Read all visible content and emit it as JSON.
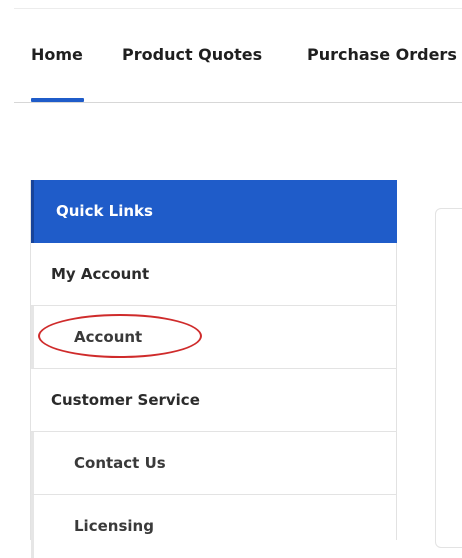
{
  "nav": {
    "tabs": [
      {
        "label": "Home",
        "active": true
      },
      {
        "label": "Product Quotes",
        "active": false
      },
      {
        "label": "Purchase Orders",
        "active": false
      }
    ]
  },
  "quick_links": {
    "title": "Quick Links",
    "items": [
      {
        "label": "My Account",
        "type": "section"
      },
      {
        "label": "Account",
        "type": "link",
        "highlighted": true
      },
      {
        "label": "Customer Service",
        "type": "section"
      },
      {
        "label": "Contact Us",
        "type": "link"
      },
      {
        "label": "Licensing",
        "type": "link"
      }
    ]
  },
  "colors": {
    "accent": "#1f5cc9",
    "highlight": "#cf2b2b"
  }
}
